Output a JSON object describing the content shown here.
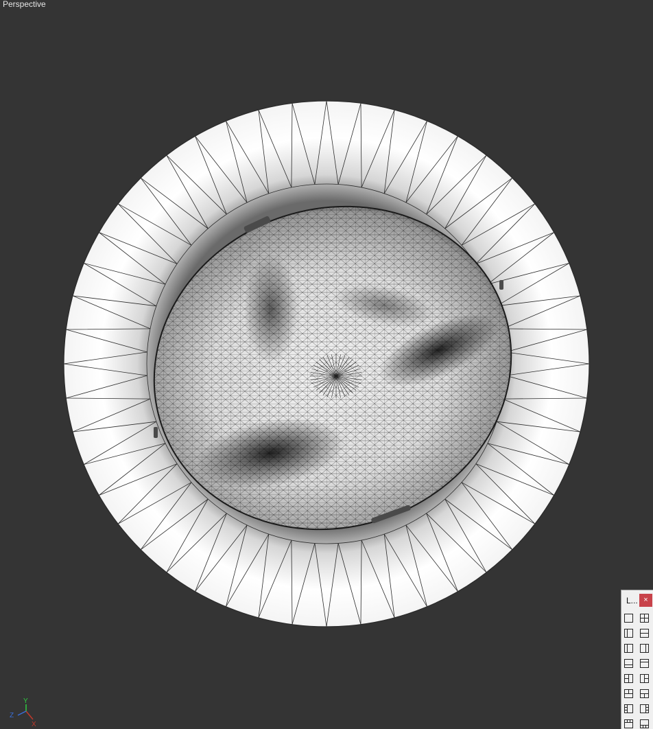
{
  "viewport": {
    "label": "Perspective",
    "background": "#343434",
    "mesh_fill": "#ffffff",
    "wire_color": "#2a2a2a"
  },
  "axis_gizmo": {
    "x_label": "X",
    "y_label": "Y",
    "z_label": "Z",
    "x_color": "#c0392b",
    "y_color": "#2ecc40",
    "z_color": "#3a6fd8"
  },
  "layout_panel": {
    "title": "L...",
    "close_label": "×",
    "close_color": "#c8424a",
    "buttons": [
      {
        "icon": "single-viewport-icon"
      },
      {
        "icon": "four-viewports-icon"
      },
      {
        "icon": "split-vertical-left-icon"
      },
      {
        "icon": "split-horizontal-icon"
      },
      {
        "icon": "split-vertical-icon"
      },
      {
        "icon": "split-vertical-right-icon"
      },
      {
        "icon": "split-horizontal-bottom-icon"
      },
      {
        "icon": "split-horizontal-top-icon"
      },
      {
        "icon": "three-viewports-left-icon"
      },
      {
        "icon": "three-viewports-right-icon"
      },
      {
        "icon": "three-viewports-top-icon"
      },
      {
        "icon": "three-viewports-bottom-icon"
      },
      {
        "icon": "four-viewports-left-icon"
      },
      {
        "icon": "four-viewports-right-icon"
      },
      {
        "icon": "four-viewports-top-icon"
      },
      {
        "icon": "four-viewports-bottom-icon"
      }
    ]
  }
}
